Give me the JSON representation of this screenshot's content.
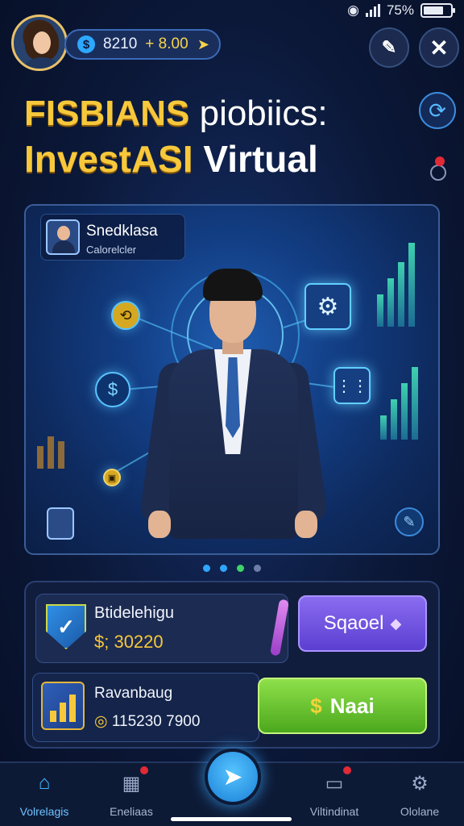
{
  "status_bar": {
    "battery": "75%",
    "battery_level": 0.75
  },
  "header": {
    "avatar_icon": "female-avatar",
    "coins": {
      "value": "8210",
      "bonus": "+ 8.00",
      "icon": "coin-icon"
    },
    "edit_icon": "edit-icon",
    "close_icon": "close-icon",
    "close_glyph": "✕"
  },
  "title": {
    "line1_highlight": "FISBIANS",
    "line1_rest": "piobiics:",
    "line2_highlight": "InvestASI",
    "line2_rest": "Virtual"
  },
  "hero": {
    "profile_name": "Snedklasa",
    "profile_sub": "Calorelcler",
    "page_indicator": {
      "count": 4,
      "active": 2
    }
  },
  "cards": {
    "balance": {
      "title": "Btidelehigu",
      "value": "$; 30220"
    },
    "action_purple": {
      "label": "Sqaoel"
    },
    "revenue": {
      "title": "Ravanbaug",
      "value_prefix": "◎",
      "value": "115230 7900"
    },
    "action_green": {
      "label": "Naai"
    }
  },
  "nav": {
    "items": [
      {
        "label": "Volrelagis",
        "icon": "home-icon",
        "glyph": "⌂",
        "active": true
      },
      {
        "label": "Eneliaas",
        "icon": "building-icon",
        "glyph": "▦",
        "badge": true
      },
      {
        "label": "Viltindinat",
        "icon": "book-icon",
        "glyph": "▭",
        "badge": true
      },
      {
        "label": "Ololane",
        "icon": "gear-icon",
        "glyph": "⚙"
      }
    ],
    "fab_icon": "send-icon"
  },
  "colors": {
    "accent_gold": "#f7c83b",
    "accent_blue": "#2fa6ff",
    "accent_green": "#4ca81c",
    "accent_purple": "#5b3fd1"
  }
}
